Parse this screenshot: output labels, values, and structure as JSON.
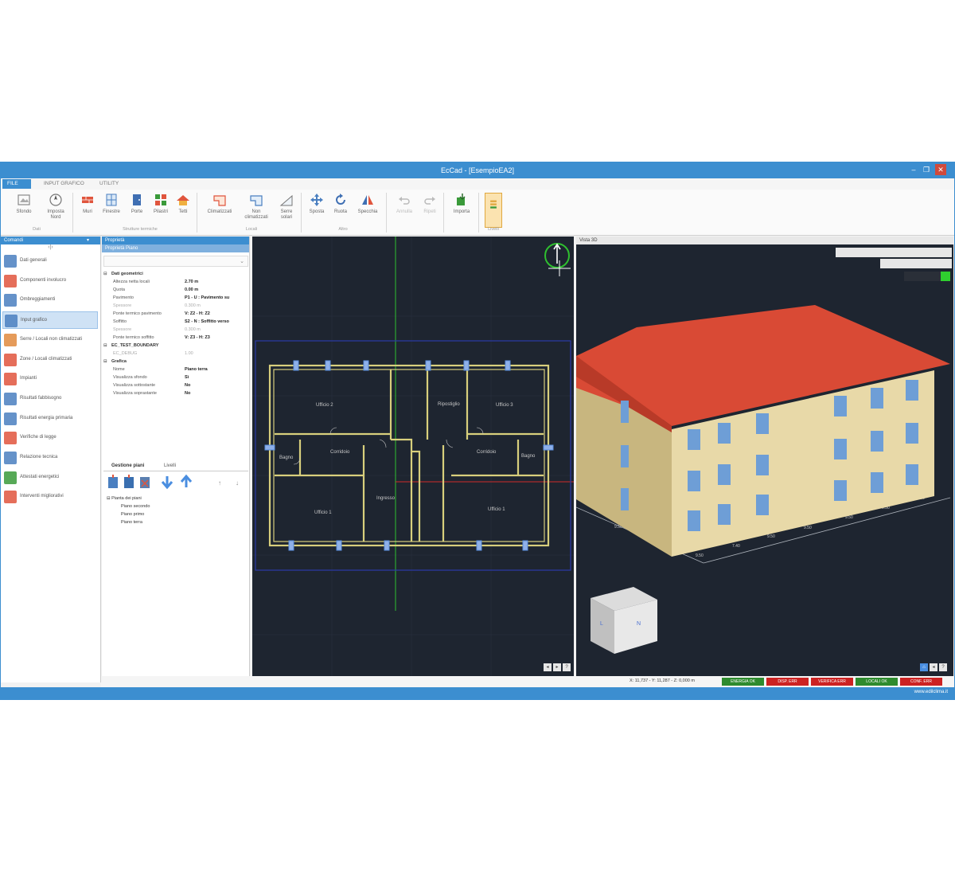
{
  "window": {
    "title": "EcCad - [EsempioEA2]"
  },
  "tabs": [
    "FILE",
    "INPUT GRAFICO",
    "UTILITY"
  ],
  "ribbon": {
    "buttons": [
      "Sfondo",
      "Imposta Nord",
      "Muri",
      "Finestre",
      "Porte",
      "Pilastri",
      "Tetti",
      "Climatizzati",
      "Non climatizzati",
      "Serre solari",
      "Sposta",
      "Ruota",
      "Specchia",
      "Annulla",
      "Ripeti",
      "Importa",
      "Livelli"
    ],
    "groups": [
      "Dati",
      "Strutture termiche",
      "Locali",
      "Altro"
    ]
  },
  "commands": {
    "header": "Comandi",
    "items": [
      "Dati generali",
      "Componenti involucro",
      "Ombreggiamenti",
      "Input grafico",
      "Serre / Locali non climatizzati",
      "Zone / Locali climatizzati",
      "Impianti",
      "Risultati fabbisogno",
      "Risultati energia primaria",
      "Verifiche di legge",
      "Relazione tecnica",
      "Attestati energetici",
      "Interventi migliorativi"
    ],
    "selected_index": 3
  },
  "properties": {
    "header": "Proprietà",
    "subheader": "Proprietà Piano",
    "rows": [
      {
        "k": "Dati geometrici",
        "v": "",
        "t": "sec"
      },
      {
        "k": "Altezza netta locali",
        "v": "2.70 m",
        "t": ""
      },
      {
        "k": "Quota",
        "v": "0.00 m",
        "t": ""
      },
      {
        "k": "Pavimento",
        "v": "P1 - U : Pavimento su",
        "t": ""
      },
      {
        "k": "Spessore",
        "v": "0.300 m",
        "t": "dim"
      },
      {
        "k": "Ponte termico pavimento",
        "v": "V: Z2 - H: Z2",
        "t": ""
      },
      {
        "k": "Soffitto",
        "v": "S2 - N : Soffitto verso",
        "t": ""
      },
      {
        "k": "Spessore",
        "v": "0.300 m",
        "t": "dim"
      },
      {
        "k": "Ponte termico soffitto",
        "v": "V: Z3 - H: Z3",
        "t": ""
      },
      {
        "k": "EC_TEST_BOUNDARY",
        "v": "",
        "t": "sec"
      },
      {
        "k": "EC_DEBUG",
        "v": "1.00",
        "t": "dim"
      },
      {
        "k": "Grafica",
        "v": "",
        "t": "sec"
      },
      {
        "k": "Nome",
        "v": "Piano terra",
        "t": ""
      },
      {
        "k": "Visualizza sfondo",
        "v": "Sì",
        "t": ""
      },
      {
        "k": "Visualizza sottostante",
        "v": "No",
        "t": ""
      },
      {
        "k": "Visualizza soprastante",
        "v": "No",
        "t": ""
      }
    ],
    "tabs": [
      "Gestione piani",
      "Livelli"
    ],
    "tree_root": "Pianta dei piani",
    "tree_items": [
      "Piano secondo",
      "Piano primo",
      "Piano terra"
    ]
  },
  "plan": {
    "rooms": [
      "Ufficio 2",
      "Ripostiglio",
      "Ufficio 3",
      "Bagno",
      "Corridoio",
      "Corridoio",
      "Bagno",
      "Ufficio 1",
      "Ingresso",
      "Ufficio 1"
    ]
  },
  "view3d": {
    "title": "Vista 3D",
    "cube_faces": [
      "L",
      "N"
    ],
    "dims": [
      "9.50",
      "9.50",
      "7.40",
      "9.50",
      "9.50",
      "9.50",
      "9.50",
      "9.50"
    ],
    "colors": {
      "roof": "#d94a35",
      "wall": "#e8d9a8",
      "wall_dark": "#c8b67f",
      "window": "#6e9ed6"
    }
  },
  "status": {
    "coords": "X: 11,737 - Y: 11,287 - Z: 0,000 m",
    "indicators": [
      {
        "label": "ENERGIA OK",
        "color": "#2e8b2e"
      },
      {
        "label": "DISP. ERR",
        "color": "#cc2222"
      },
      {
        "label": "VERIFICA ERR",
        "color": "#cc2222"
      },
      {
        "label": "LOCALI OK",
        "color": "#2e8b2e"
      },
      {
        "label": "CONF. ERR",
        "color": "#cc2222"
      }
    ]
  },
  "footer": {
    "brand": "www.edilclima.it"
  }
}
